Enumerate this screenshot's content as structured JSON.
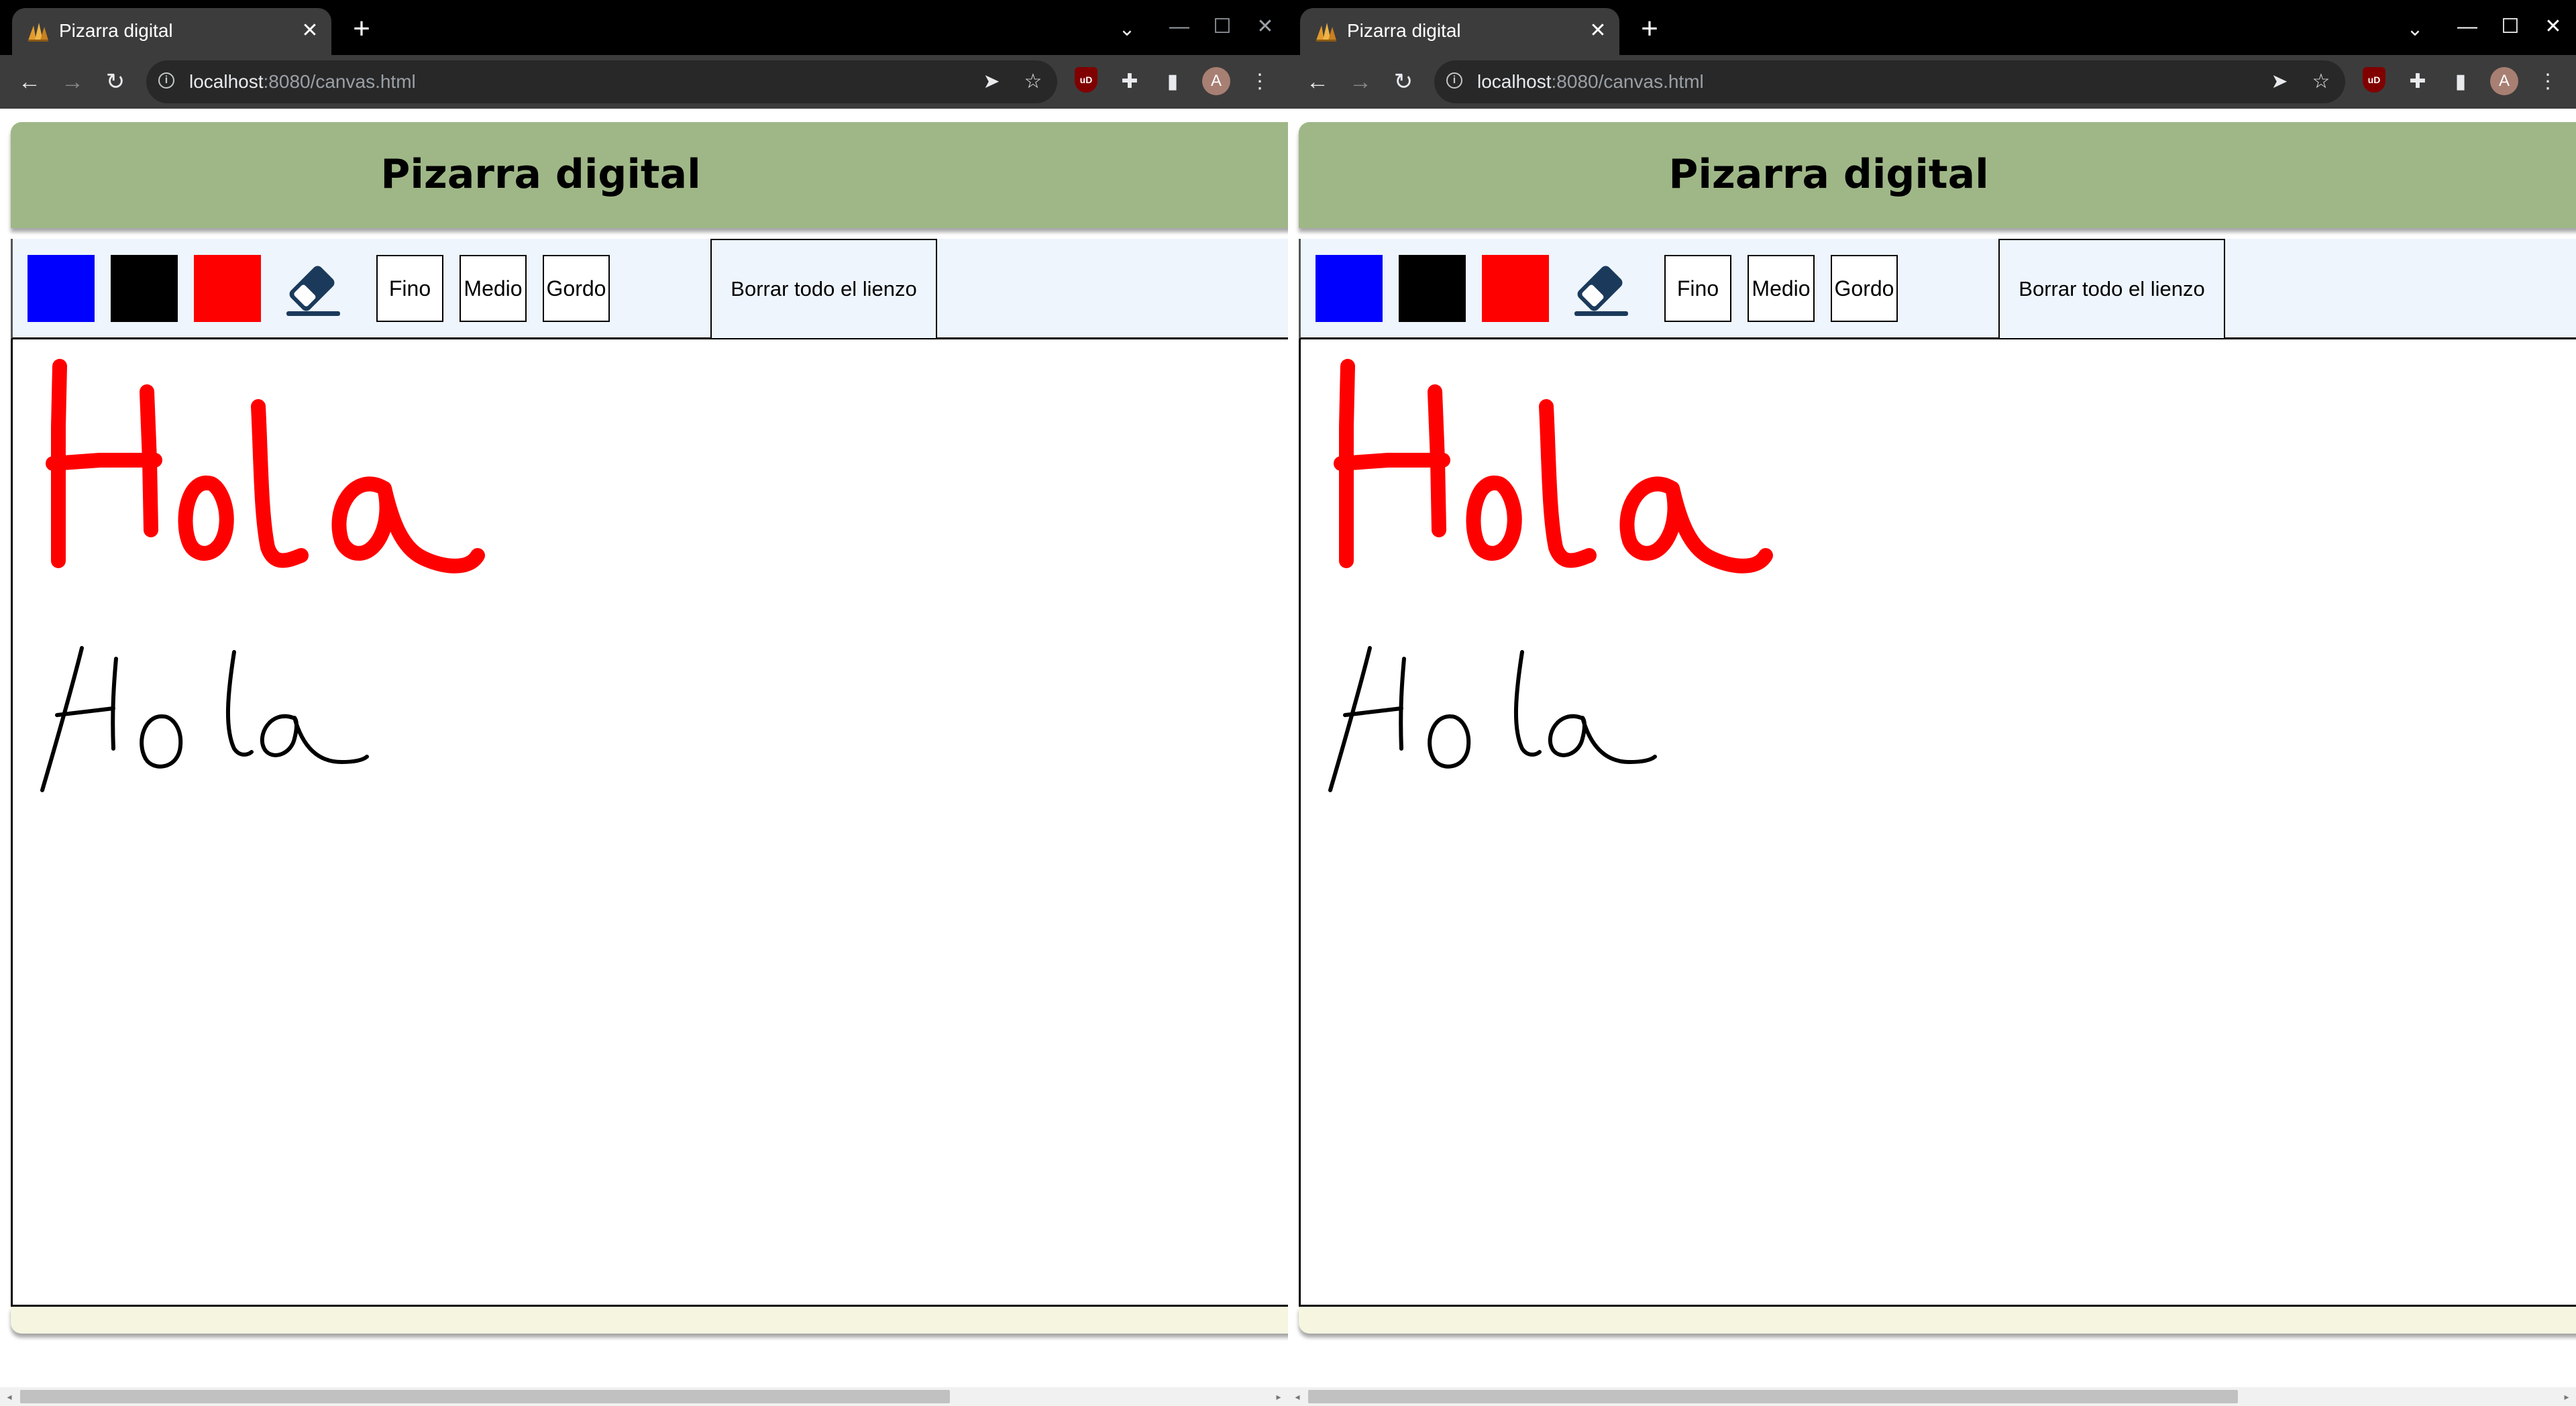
{
  "windows": [
    {
      "tab": {
        "title": "Pizarra digital",
        "close": "✕"
      },
      "new_tab": "+",
      "tab_search": "⌄",
      "controls": {
        "minimize": "—",
        "maximize": "☐",
        "close": "✕"
      },
      "nav": {
        "back": "←",
        "forward": "→",
        "reload": "↻"
      },
      "address": {
        "host": "localhost",
        "path": ":8080/canvas.html"
      },
      "toolbar_icons": {
        "share": "➤",
        "star": "☆",
        "ublock": "uD",
        "extensions": "✚",
        "sidepanel": "▮",
        "menu": "⋮"
      },
      "profile_initial": "A",
      "page": {
        "title": "Pizarra digital",
        "colors": [
          {
            "name": "blue",
            "hex": "#0000ff"
          },
          {
            "name": "black",
            "hex": "#000000"
          },
          {
            "name": "red",
            "hex": "#ff0000"
          }
        ],
        "sizes": [
          "Fino",
          "Medio",
          "Gordo"
        ],
        "clear_label": "Borrar todo el lienzo"
      }
    },
    {
      "tab": {
        "title": "Pizarra digital",
        "close": "✕"
      },
      "new_tab": "+",
      "tab_search": "⌄",
      "controls": {
        "minimize": "—",
        "maximize": "☐",
        "close": "✕"
      },
      "nav": {
        "back": "←",
        "forward": "→",
        "reload": "↻"
      },
      "address": {
        "host": "localhost",
        "path": ":8080/canvas.html"
      },
      "toolbar_icons": {
        "share": "➤",
        "star": "☆",
        "ublock": "uD",
        "extensions": "✚",
        "sidepanel": "▮",
        "menu": "⋮"
      },
      "profile_initial": "A",
      "page": {
        "title": "Pizarra digital",
        "colors": [
          {
            "name": "blue",
            "hex": "#0000ff"
          },
          {
            "name": "black",
            "hex": "#000000"
          },
          {
            "name": "red",
            "hex": "#ff0000"
          }
        ],
        "sizes": [
          "Fino",
          "Medio",
          "Gordo"
        ],
        "clear_label": "Borrar todo el lienzo"
      }
    }
  ],
  "theme": {
    "tab_bar": "#000000",
    "toolbar": "#3c3c3c",
    "header_green": "#9fb787",
    "controls_bg": "#eef5fd",
    "footer_bg": "#f5f5e0",
    "ink_red": "#ff0000",
    "ink_black": "#000000"
  }
}
